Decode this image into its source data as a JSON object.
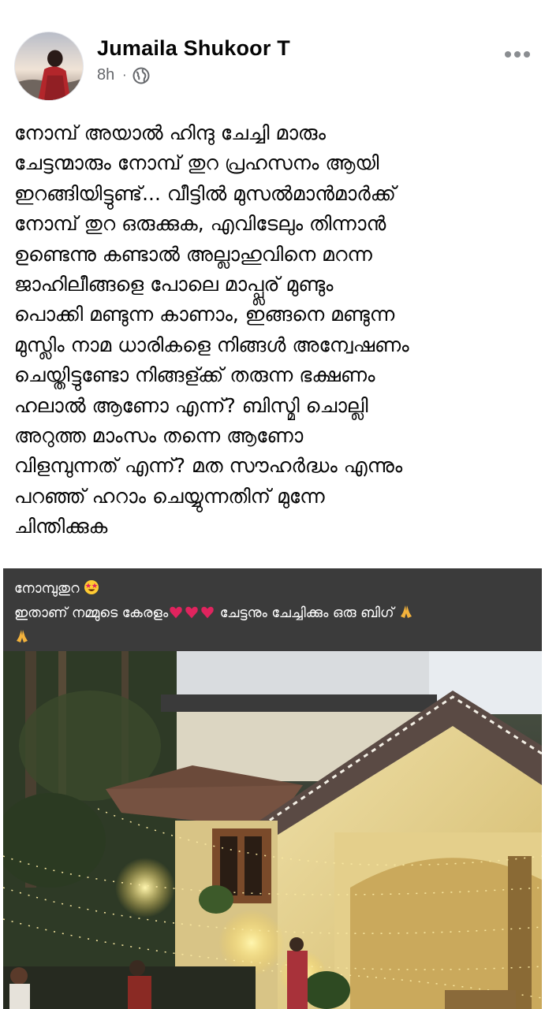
{
  "post": {
    "author": "Jumaila Shukoor T",
    "time": "8h",
    "separator": "·",
    "privacy_icon": "globe-icon",
    "more_icon": "more-horizontal-icon",
    "text_lines": [
      "നോമ്പ് അയാൽ ഹിന്ദു  ചേച്ചി മാരും",
      "ചേട്ടന്മാരും നോമ്പ് തുറ പ്രഹസനം ആയി",
      "ഇറങ്ങിയിട്ടുണ്ട്... വീട്ടിൽ മുസൽമാൻമാർക്ക്",
      "നോമ്പ് തുറ ഒരുക്കുക, എവിടേലും തിന്നാൻ",
      "ഉണ്ടെന്നു കണ്ടാൽ അല്ലാഹുവിനെ മറന്ന",
      "ജാഹിലീങ്ങളെ പോലെ മാപ്പ്ലര് മുണ്ടും",
      "പൊക്കി മണ്ടുന്ന കാണാം, ഇങ്ങനെ മണ്ടുന്ന",
      "മുസ്ലിം നാമ ധാരികളെ നിങ്ങൾ അന്വേഷണം",
      "ചെയ്തിട്ടുണ്ടോ നിങ്ങള്ക്ക് തരുന്ന ഭക്ഷണം",
      "ഹലാൽ ആണോ എന്ന്? ബിസ്മി ചൊല്ലി",
      "അറുത്ത മാംസം തന്നെ ആണോ",
      "വിളമ്പുന്നത് എന്ന്? മത സൗഹർദ്ധം എന്നും",
      "പറഞ്ഞ് ഹറാം ചെയ്യുന്നതിന് മുന്നേ",
      "ചിന്തിക്കുക"
    ]
  },
  "shared_image": {
    "caption_line1": "നോമ്പുതുറ",
    "caption_line1_emoji": "star-struck-emoji",
    "caption_line2": "ഇതാണ് നമ്മുടെ കേരളം",
    "caption_line2_hearts": "red-heart-emoji x3",
    "caption_line2_rest": " ചേട്ടനും ചേച്ചിക്കും ഒരു ബിഗ് ",
    "caption_line2_emoji": "folded-hands-emoji x2",
    "photo_description_icon": "house-with-lights-photo"
  },
  "colors": {
    "text": "#050505",
    "meta": "#65676b",
    "caption_bg": "#3b3b3b",
    "wall": "#e6d59a",
    "roof": "#6b4a3a",
    "heart": "#e0245e"
  }
}
